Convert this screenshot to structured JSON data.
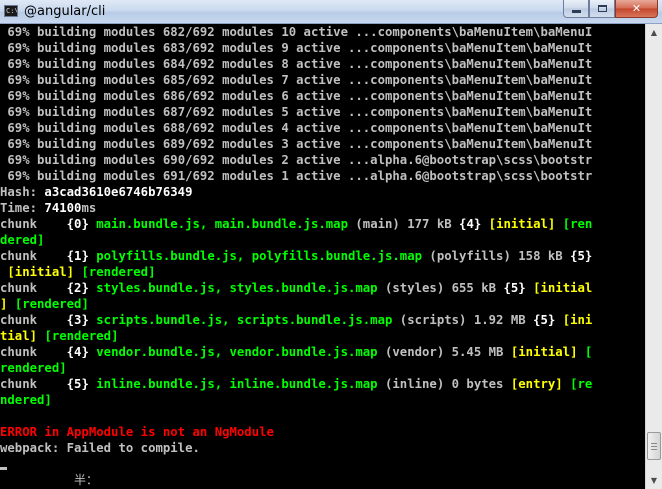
{
  "window": {
    "title": "@angular/cli",
    "icon_name": "console-icon",
    "icon_glyph": "C:\\",
    "minimize_glyph": "",
    "maximize_glyph": "",
    "close_glyph": "✕"
  },
  "console": {
    "build_lines": [
      {
        "pct": " 69%",
        "text": " building modules 682/692 modules 10 active ...components\\baMenuItem\\baMenuI"
      },
      {
        "pct": " 69%",
        "text": " building modules 683/692 modules 9 active ...components\\baMenuItem\\baMenuIt"
      },
      {
        "pct": " 69%",
        "text": " building modules 684/692 modules 8 active ...components\\baMenuItem\\baMenuIt"
      },
      {
        "pct": " 69%",
        "text": " building modules 685/692 modules 7 active ...components\\baMenuItem\\baMenuIt"
      },
      {
        "pct": " 69%",
        "text": " building modules 686/692 modules 6 active ...components\\baMenuItem\\baMenuIt"
      },
      {
        "pct": " 69%",
        "text": " building modules 687/692 modules 5 active ...components\\baMenuItem\\baMenuIt"
      },
      {
        "pct": " 69%",
        "text": " building modules 688/692 modules 4 active ...components\\baMenuItem\\baMenuIt"
      },
      {
        "pct": " 69%",
        "text": " building modules 689/692 modules 3 active ...components\\baMenuItem\\baMenuIt"
      },
      {
        "pct": " 69%",
        "text": " building modules 690/692 modules 2 active ...alpha.6@bootstrap\\scss\\bootstr"
      },
      {
        "pct": " 69%",
        "text": " building modules 691/692 modules 1 active ...alpha.6@bootstrap\\scss\\bootstr"
      }
    ],
    "hash_label": "Hash: ",
    "hash_value": "a3cad3610e6746b76349",
    "time_label": "Time: ",
    "time_value": "74100",
    "time_unit": "ms",
    "chunks": [
      {
        "l1_prefix": "chunk    ",
        "l1_id": "{0}",
        "l1_files": " main.bundle.js, main.bundle.js.map",
        "l1_meta": " (main) 177 kB ",
        "l1_parent": "{4}",
        "l1_flag": " [initial] [ren",
        "l2_green": "dered]",
        "l2_rest": ""
      },
      {
        "l1_prefix": "chunk    ",
        "l1_id": "{1}",
        "l1_files": " polyfills.bundle.js, polyfills.bundle.js.map",
        "l1_meta": " (polyfills) 158 kB ",
        "l1_parent": "{5}",
        "l1_flag": "",
        "l2_green": " [initial] [rendered]",
        "l2_rest": ""
      },
      {
        "l1_prefix": "chunk    ",
        "l1_id": "{2}",
        "l1_files": " styles.bundle.js, styles.bundle.js.map",
        "l1_meta": " (styles) 655 kB ",
        "l1_parent": "{5}",
        "l1_flag": " [initial",
        "l2_green": "] [rendered]",
        "l2_rest": ""
      },
      {
        "l1_prefix": "chunk    ",
        "l1_id": "{3}",
        "l1_files": " scripts.bundle.js, scripts.bundle.js.map",
        "l1_meta": " (scripts) 1.92 MB ",
        "l1_parent": "{5}",
        "l1_flag": " [ini",
        "l2_green": "tial] [rendered]",
        "l2_rest": ""
      },
      {
        "l1_prefix": "chunk    ",
        "l1_id": "{4}",
        "l1_files": " vendor.bundle.js, vendor.bundle.js.map",
        "l1_meta": " (vendor) 5.45 MB ",
        "l1_parent": "",
        "l1_flag": "[initial] [",
        "l2_green": "rendered]",
        "l2_rest": ""
      },
      {
        "l1_prefix": "chunk    ",
        "l1_id": "{5}",
        "l1_files": " inline.bundle.js, inline.bundle.js.map",
        "l1_meta": " (inline) 0 bytes ",
        "l1_parent": "",
        "l1_flag": "[entry] [re",
        "l2_green": "ndered]",
        "l2_rest": ""
      }
    ],
    "error_line": "ERROR in AppModule is not an NgModule",
    "webpack_line": "webpack: Failed to compile.",
    "ime_indicator": "半："
  },
  "colors": {
    "background": "#000000",
    "text": "#c0c0c0",
    "green": "#00ff00",
    "yellow": "#ffff00",
    "red": "#ff0000",
    "white": "#ffffff"
  }
}
